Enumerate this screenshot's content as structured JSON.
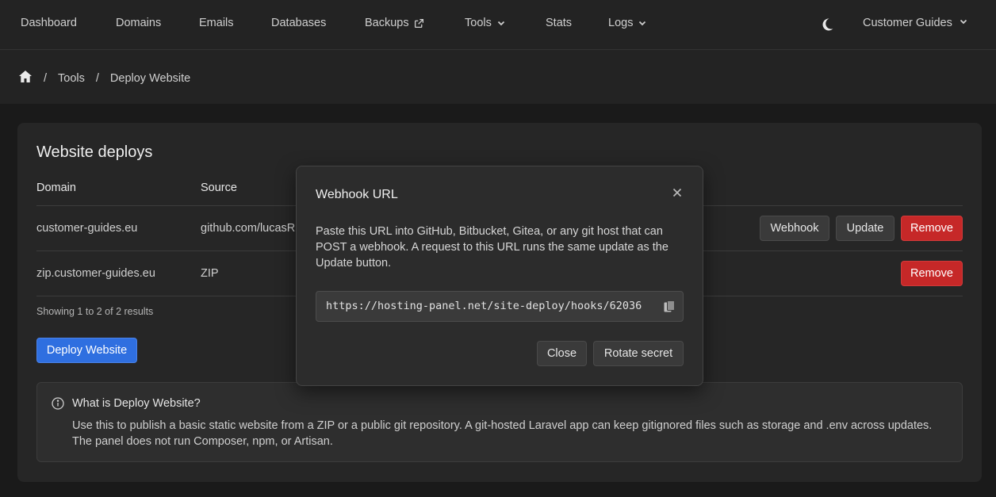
{
  "nav": {
    "items": [
      {
        "label": "Dashboard"
      },
      {
        "label": "Domains"
      },
      {
        "label": "Emails"
      },
      {
        "label": "Databases"
      },
      {
        "label": "Backups",
        "icon": "external-link-icon"
      },
      {
        "label": "Tools",
        "icon": "chevron-down-icon"
      },
      {
        "label": "Stats"
      },
      {
        "label": "Logs",
        "icon": "chevron-down-icon"
      }
    ],
    "theme_icon": "moon-icon",
    "account": "Customer Guides"
  },
  "breadcrumb": {
    "home_icon": "home-icon",
    "items": [
      "Tools",
      "Deploy Website"
    ],
    "separator": "/"
  },
  "card": {
    "title": "Website deploys",
    "columns": [
      "Domain",
      "Source"
    ],
    "rows": [
      {
        "domain": "customer-guides.eu",
        "source": "github.com/lucasR",
        "actions": [
          "Webhook",
          "Update",
          "Remove"
        ]
      },
      {
        "domain": "zip.customer-guides.eu",
        "source": "ZIP",
        "actions": [
          "Remove"
        ]
      }
    ],
    "results": "Showing 1 to 2 of 2 results",
    "deploy_button": "Deploy Website"
  },
  "info": {
    "icon": "info-icon",
    "title": "What is Deploy Website?",
    "text": "Use this to publish a basic static website from a ZIP or a public git repository. A git-hosted Laravel app can keep gitignored files such as storage and .env across updates. The panel does not run Composer, npm, or Artisan."
  },
  "modal": {
    "title": "Webhook URL",
    "description": "Paste this URL into GitHub, Bitbucket, Gitea, or any git host that can POST a webhook. A request to this URL runs the same update as the Update button.",
    "url": "https://hosting-panel.net/site-deploy/hooks/62036",
    "copy_icon": "copy-icon",
    "close_icon": "close-icon",
    "close_button": "Close",
    "rotate_button": "Rotate secret"
  },
  "colors": {
    "danger": "#c62828",
    "primary": "#2f6fe0",
    "background": "#1a1a1a",
    "panel": "#262626"
  }
}
